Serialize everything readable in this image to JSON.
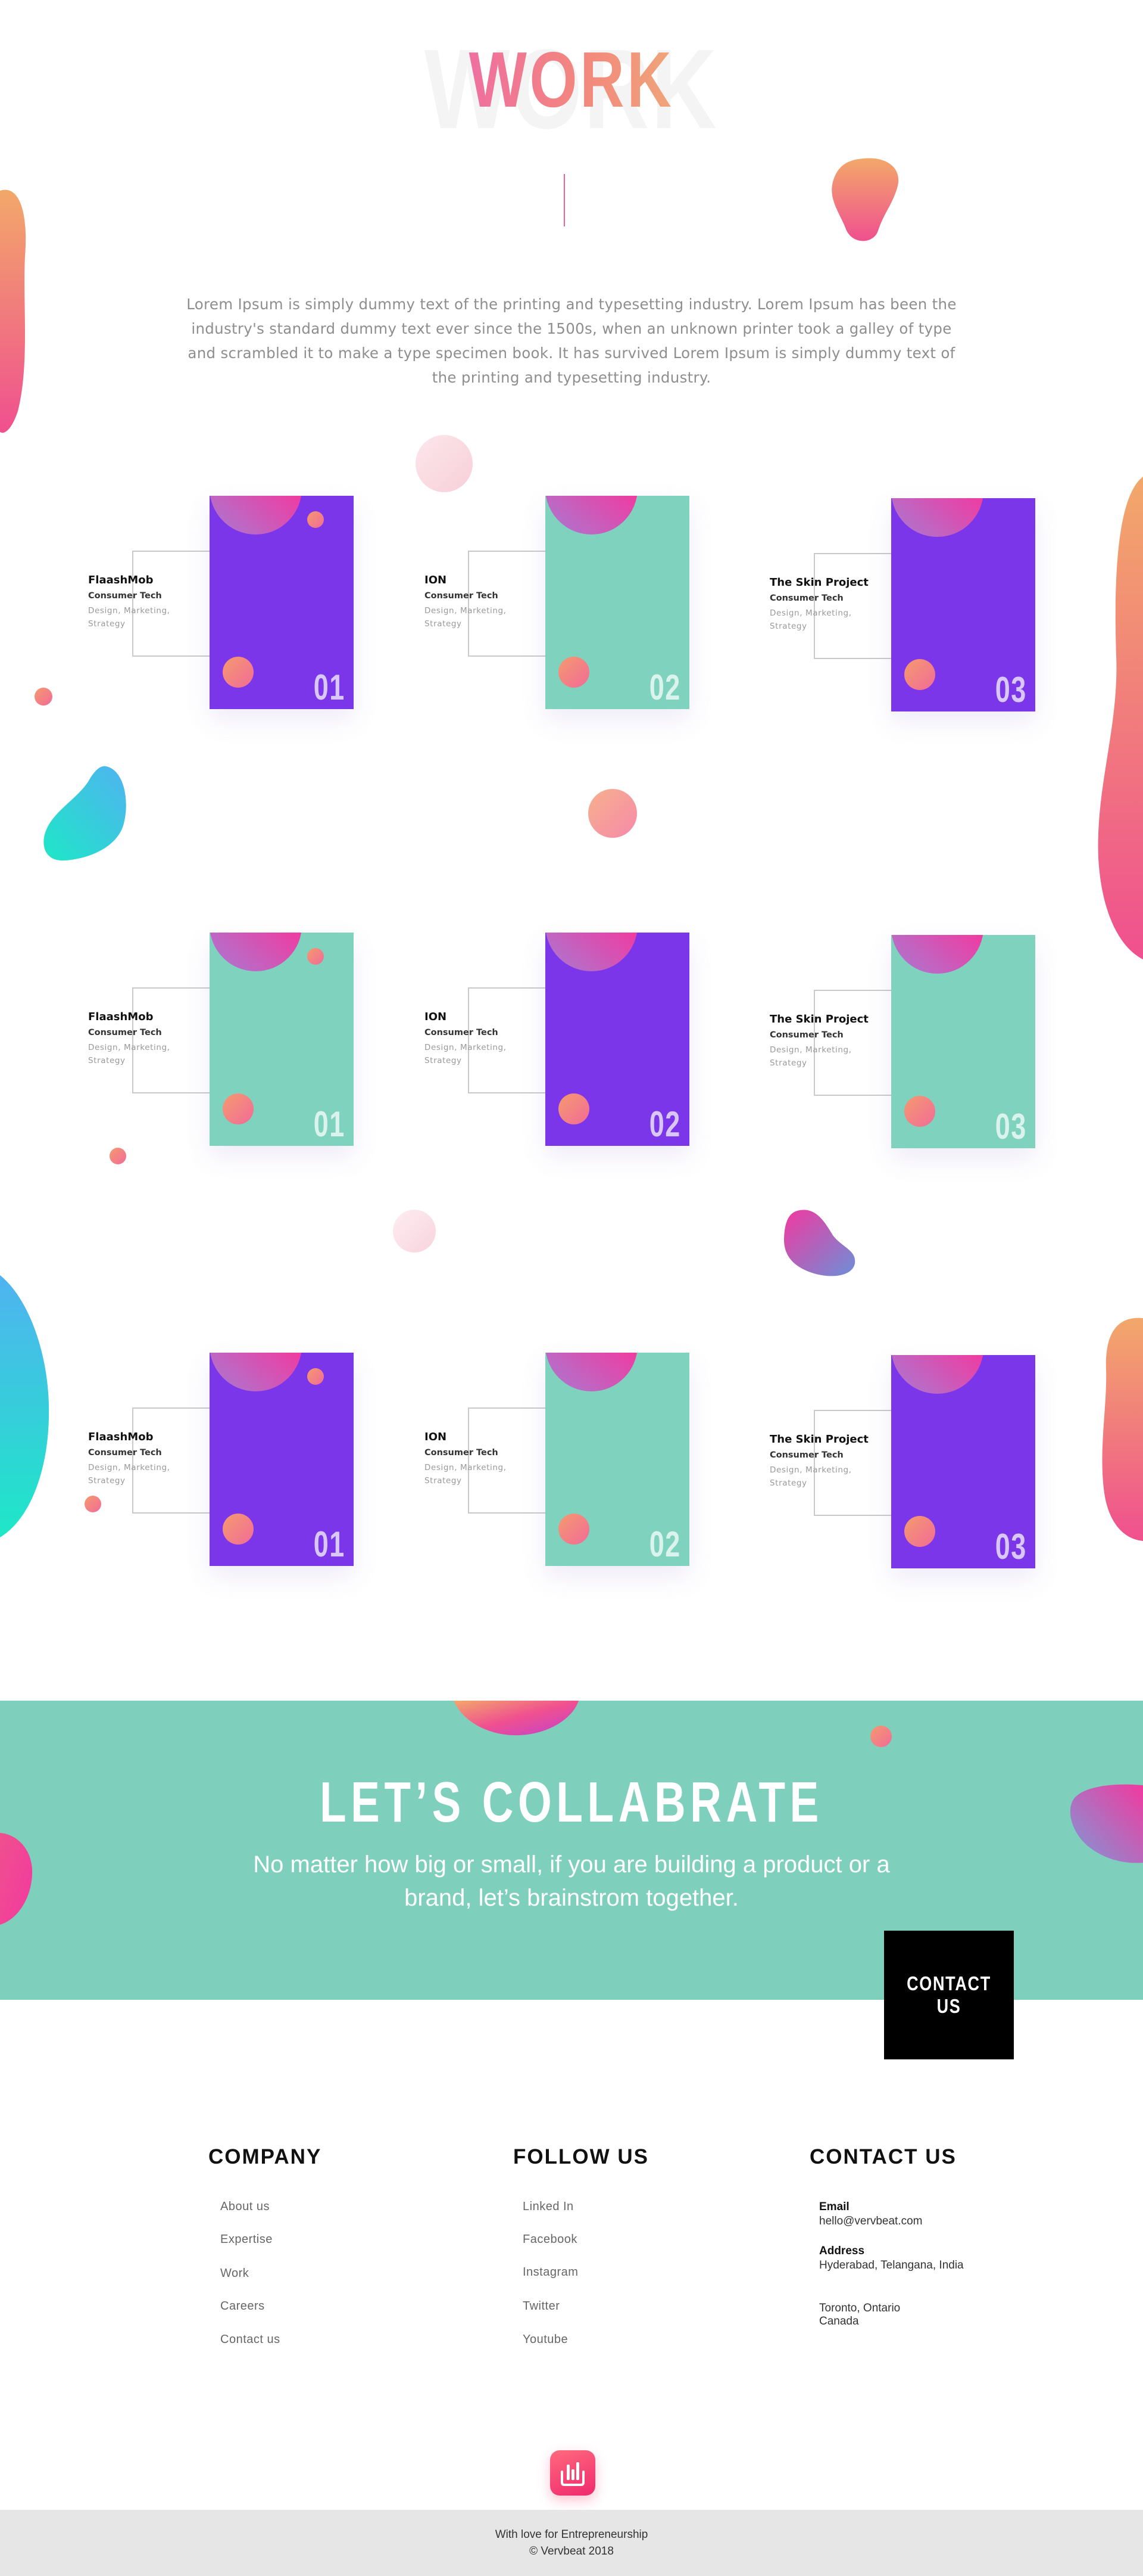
{
  "header": {
    "title": "WORK",
    "intro": "Lorem Ipsum is simply dummy text of the printing and typesetting industry. Lorem Ipsum has been the industry's standard dummy text ever since the 1500s, when an unknown printer took a galley of type and scrambled it to make a type specimen book. It has survived Lorem Ipsum is simply dummy text of the printing and typesetting industry."
  },
  "projects": [
    {
      "name": "FlaashMob",
      "category": "Consumer Tech",
      "services": "Design, Marketing, Strategy",
      "number": "01",
      "color": "#7b36ea"
    },
    {
      "name": "ION",
      "category": "Consumer Tech",
      "services": "Design, Marketing, Strategy",
      "number": "02",
      "color": "#7fd3be"
    },
    {
      "name": "The Skin Project",
      "category": "Consumer Tech",
      "services": "Design, Marketing, Strategy",
      "number": "03",
      "color": "#7b36ea"
    },
    {
      "name": "FlaashMob",
      "category": "Consumer Tech",
      "services": "Design, Marketing, Strategy",
      "number": "01",
      "color": "#7fd3be"
    },
    {
      "name": "ION",
      "category": "Consumer Tech",
      "services": "Design, Marketing, Strategy",
      "number": "02",
      "color": "#7b36ea"
    },
    {
      "name": "The Skin Project",
      "category": "Consumer Tech",
      "services": "Design, Marketing, Strategy",
      "number": "03",
      "color": "#7fd3be"
    },
    {
      "name": "FlaashMob",
      "category": "Consumer Tech",
      "services": "Design, Marketing, Strategy",
      "number": "01",
      "color": "#7b36ea"
    },
    {
      "name": "ION",
      "category": "Consumer Tech",
      "services": "Design, Marketing, Strategy",
      "number": "02",
      "color": "#7fd3be"
    },
    {
      "name": "The Skin Project",
      "category": "Consumer Tech",
      "services": "Design, Marketing, Strategy",
      "number": "03",
      "color": "#7b36ea"
    }
  ],
  "collab": {
    "title": "LET’S COLLABRATE",
    "text": "No matter how big or small, if you are building a product or a brand, let’s brainstrom together.",
    "button": "CONTACT US",
    "bg": "#7ed0bd"
  },
  "footer": {
    "company": {
      "heading": "COMPANY",
      "links": [
        "About us",
        "Expertise",
        "Work",
        "Careers",
        "Contact us"
      ]
    },
    "follow": {
      "heading": "FOLLOW US",
      "links": [
        "Linked In",
        "Facebook",
        "Instagram",
        "Twitter",
        "Youtube"
      ]
    },
    "contact": {
      "heading": "CONTACT US",
      "email_label": "Email",
      "email": "hello@vervbeat.com",
      "address_label": "Address",
      "address1": "Hyderabad, Telangana, India",
      "address2": "Toronto, Ontario Canada"
    },
    "tagline": "With love for Entrepreneurship",
    "copyright": "© Vervbeat  2018"
  },
  "colors": {
    "purple": "#7b36ea",
    "teal": "#7fd3be",
    "pink": "#f2399f",
    "peach": "#f49a6f"
  },
  "icons": [
    "vervbeat-logo-icon"
  ]
}
